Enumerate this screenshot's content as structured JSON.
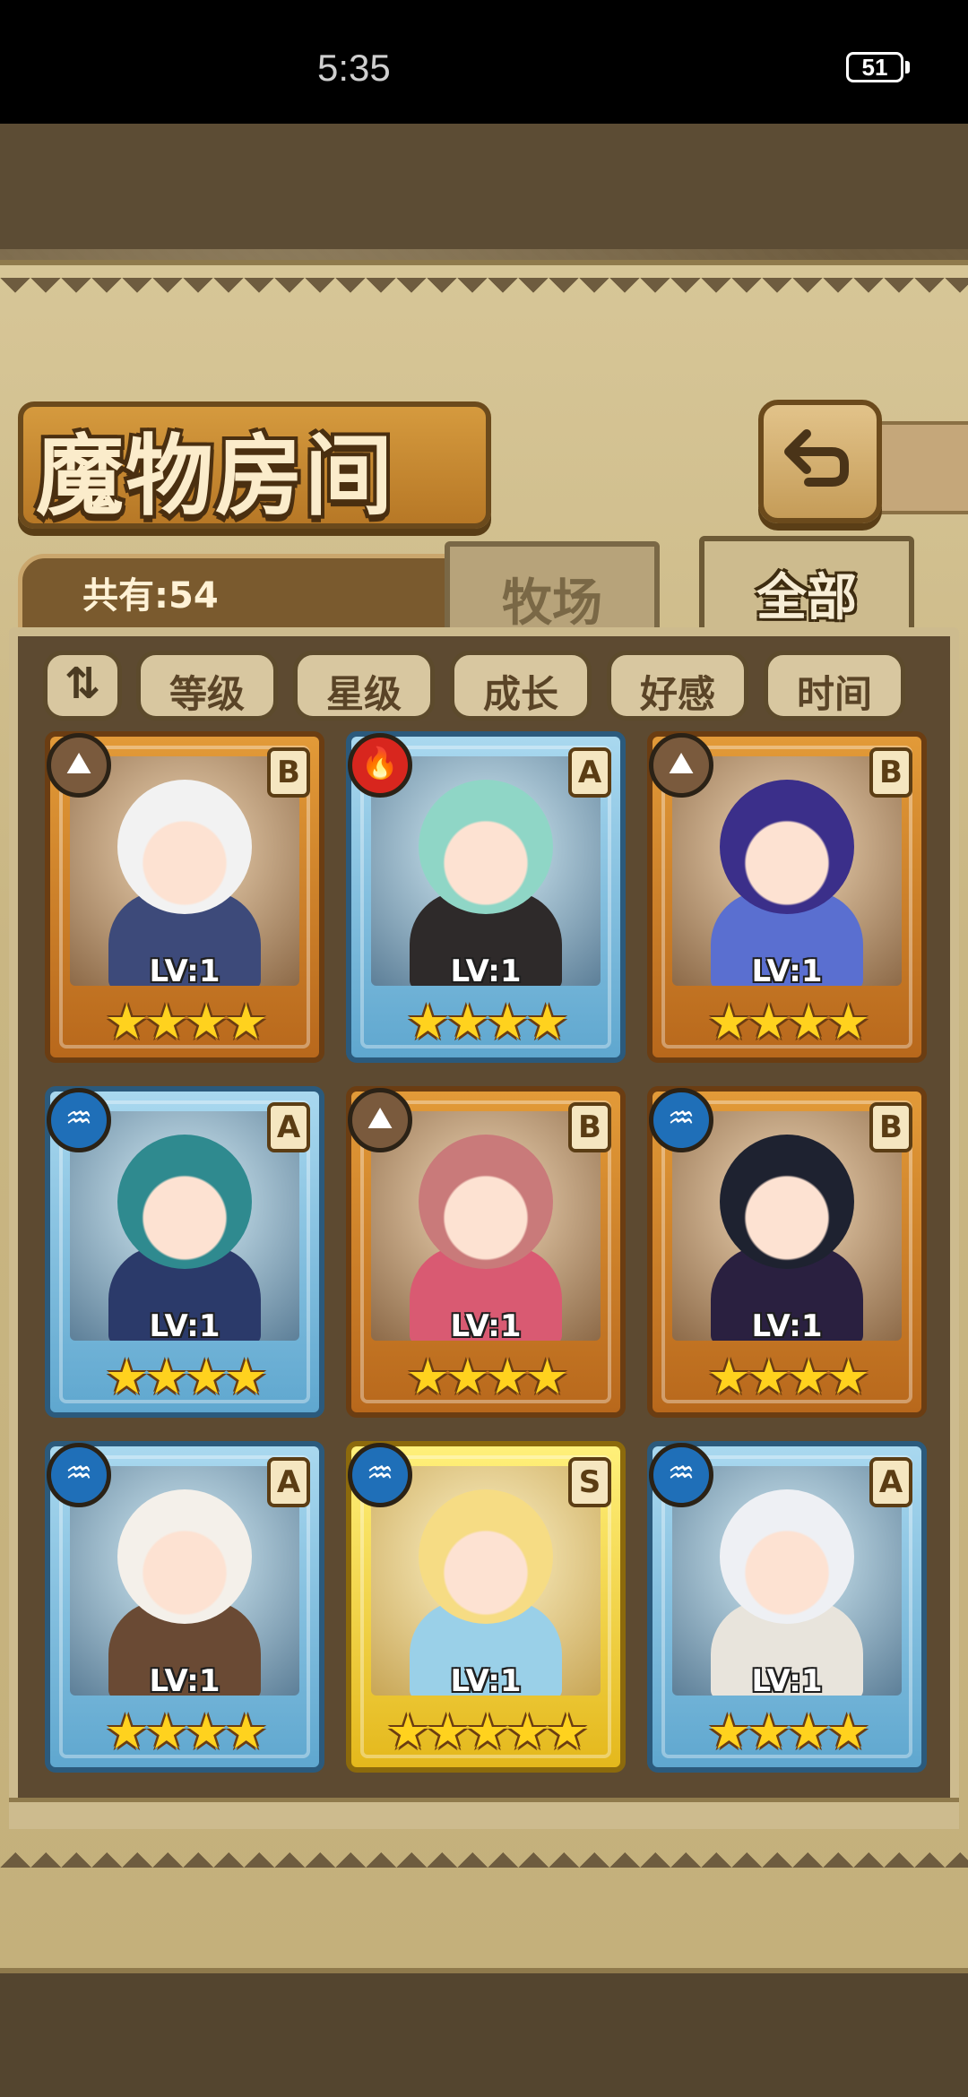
{
  "status_bar": {
    "time": "5:35",
    "battery": "51"
  },
  "header": {
    "title": "魔物房间"
  },
  "info": {
    "count_label": "共有:54"
  },
  "tabs": [
    {
      "label": "牧场",
      "active": false
    },
    {
      "label": "全部",
      "active": true
    }
  ],
  "sort": {
    "toggle_icon": "ascending-descending-icon",
    "toggle_glyph": "⇅",
    "buttons": [
      "等级",
      "星级",
      "成长",
      "好感",
      "时间"
    ]
  },
  "cards": [
    {
      "element": "earth",
      "element_glyph": "⛰",
      "rank": "B",
      "level": "LV:1",
      "stars": "★★★★",
      "frame": "bronze",
      "hair": "#f2f2f2",
      "outfit": "#3d4a7a"
    },
    {
      "element": "fire",
      "element_glyph": "🔥",
      "rank": "A",
      "level": "LV:1",
      "stars": "★★★★",
      "frame": "blue",
      "hair": "#8fd6c6",
      "outfit": "#2e2a2a"
    },
    {
      "element": "earth",
      "element_glyph": "⛰",
      "rank": "B",
      "level": "LV:1",
      "stars": "★★★★",
      "frame": "bronze",
      "hair": "#3b2f8a",
      "outfit": "#5a6fd0"
    },
    {
      "element": "water",
      "element_glyph": "♒",
      "rank": "A",
      "level": "LV:1",
      "stars": "★★★★",
      "frame": "blue",
      "hair": "#2f8a8f",
      "outfit": "#2b3a6a"
    },
    {
      "element": "earth",
      "element_glyph": "⛰",
      "rank": "B",
      "level": "LV:1",
      "stars": "★★★★",
      "frame": "bronze",
      "hair": "#c97a7a",
      "outfit": "#d95a72"
    },
    {
      "element": "water",
      "element_glyph": "♒",
      "rank": "B",
      "level": "LV:1",
      "stars": "★★★★",
      "frame": "bronze",
      "hair": "#1e2230",
      "outfit": "#2a2040"
    },
    {
      "element": "water",
      "element_glyph": "♒",
      "rank": "A",
      "level": "LV:1",
      "stars": "★★★★",
      "frame": "blue",
      "hair": "#f4f0ea",
      "outfit": "#6a4a34"
    },
    {
      "element": "water",
      "element_glyph": "♒",
      "rank": "S",
      "level": "LV:1",
      "stars": "★★★★★",
      "frame": "gold",
      "hair": "#f6dc84",
      "outfit": "#9ad0e8"
    },
    {
      "element": "water",
      "element_glyph": "♒",
      "rank": "A",
      "level": "LV:1",
      "stars": "★★★★",
      "frame": "blue",
      "hair": "#eef0f4",
      "outfit": "#e8e4dc"
    }
  ]
}
